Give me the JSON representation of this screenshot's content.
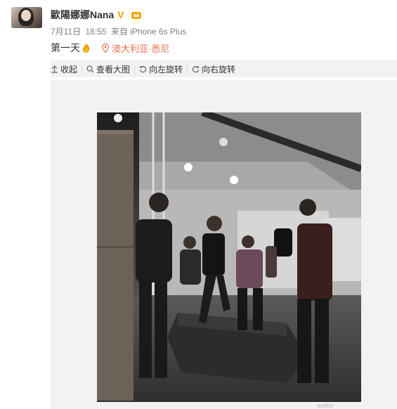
{
  "post": {
    "author_name": "歐陽娜娜Nana",
    "verified_mark": "V",
    "date": "7月11日",
    "time": "18:55",
    "source": "来自 iPhone 6s Plus",
    "text": "第一天",
    "location": "澳大利亚·悉尼"
  },
  "toolbar": {
    "collapse_label": "收起",
    "view_large_label": "查看大图",
    "rotate_left_label": "向左旋转",
    "rotate_right_label": "向右旋转"
  },
  "colors": {
    "name": "#333333",
    "meta": "#808080",
    "location": "#eb7350",
    "verified": "#f6a400",
    "toolbar_bg": "#f2f2f5"
  },
  "icons": [
    "avatar",
    "verified-v-icon",
    "member-crown-icon",
    "flame-emoji-icon",
    "location-pin-icon",
    "collapse-up-icon",
    "search-icon",
    "rotate-left-icon",
    "rotate-right-icon"
  ]
}
